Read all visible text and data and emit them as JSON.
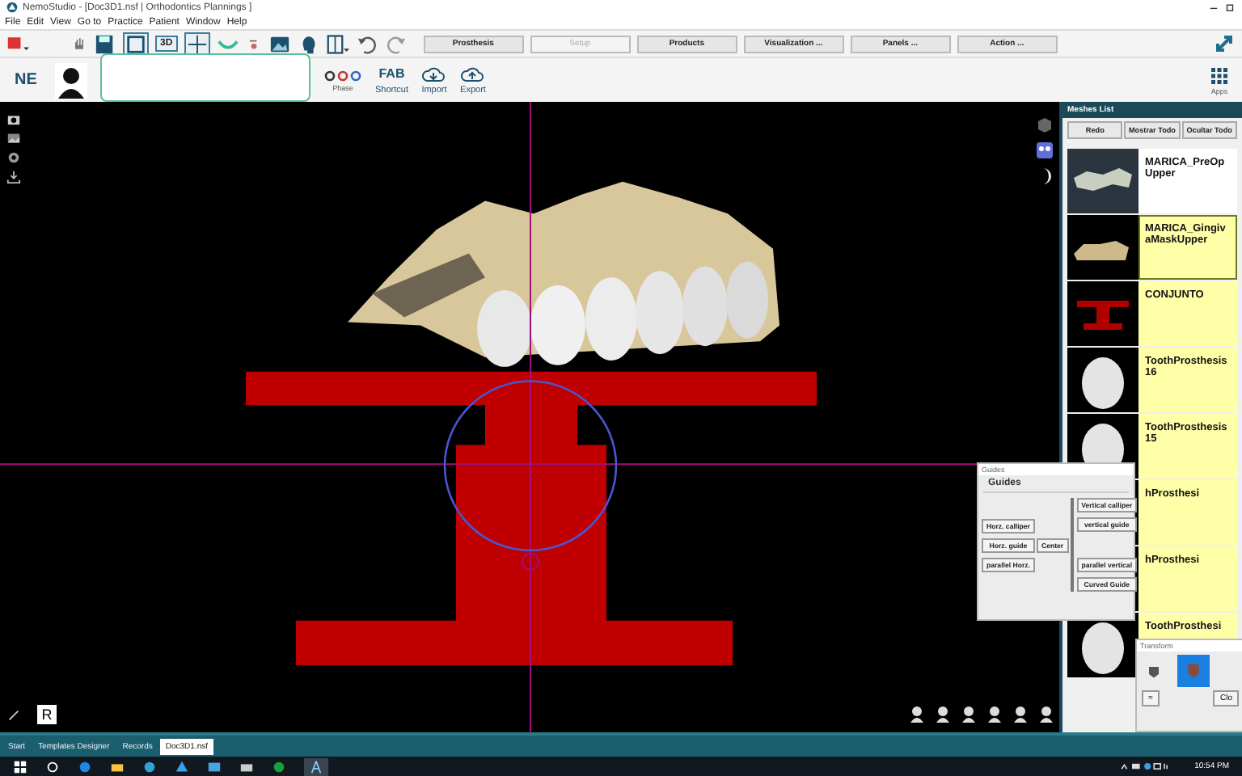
{
  "window": {
    "title": "NemoStudio - [Doc3D1.nsf | Orthodontics Plannings ]"
  },
  "menu": [
    "File",
    "Edit",
    "View",
    "Go to",
    "Practice",
    "Patient",
    "Window",
    "Help"
  ],
  "toolbar_buttons": [
    {
      "label": "Prosthesis",
      "disabled": false
    },
    {
      "label": "Setup",
      "disabled": true
    },
    {
      "label": "Products",
      "disabled": false
    },
    {
      "label": "Visualization ...",
      "disabled": false
    },
    {
      "label": "Panels ...",
      "disabled": false
    },
    {
      "label": "Action ...",
      "disabled": false
    }
  ],
  "view_3d_label": "3D",
  "ribbon": {
    "logo": "NE",
    "fab": "FAB",
    "phase_label": "Phase",
    "shortcut": "Shortcut",
    "import": "Import",
    "export": "Export",
    "apps": "Apps"
  },
  "meshes_list": {
    "title": "Meshes List",
    "buttons": [
      "Redo",
      "Mostrar Todo",
      "Ocultar Todo"
    ],
    "items": [
      {
        "name": "MARICA_PreOpUpper",
        "kind": "gumlight",
        "selected": false,
        "active": false
      },
      {
        "name": "MARICA_GingivaMaskUpper",
        "kind": "gum",
        "selected": true,
        "active": true
      },
      {
        "name": "CONJUNTO",
        "kind": "block",
        "selected": false,
        "active": true
      },
      {
        "name": "ToothProsthesis16",
        "kind": "tooth",
        "selected": false,
        "active": true
      },
      {
        "name": "ToothProsthesis15",
        "kind": "tooth",
        "selected": false,
        "active": true
      },
      {
        "name": "hProsthesi",
        "kind": "tooth",
        "selected": false,
        "active": true
      },
      {
        "name": "hProsthesi",
        "kind": "tooth",
        "selected": false,
        "active": true
      },
      {
        "name": "ToothProsthesi",
        "kind": "tooth",
        "selected": false,
        "active": true
      }
    ]
  },
  "guides_dialog": {
    "title": "Guides",
    "group": "Guides",
    "left_buttons": [
      "Horz. calliper",
      "Horz. guide",
      "parallel Horz."
    ],
    "center": "Center",
    "right_top_buttons": [
      "Vertical calliper",
      "vertical guide"
    ],
    "right_bottom_buttons": [
      "parallel vertical",
      "Curved Guide"
    ]
  },
  "transform_dialog": {
    "title": "Transform",
    "button": "≈",
    "close": "Clo"
  },
  "viewport": {
    "reset_key": "R"
  },
  "doc_tabs": [
    {
      "label": "Start",
      "selected": false
    },
    {
      "label": "Templates Designer",
      "selected": false
    },
    {
      "label": "Records",
      "selected": false
    },
    {
      "label": "Doc3D1.nsf",
      "selected": true
    }
  ],
  "taskbar": {
    "time": "10:54 PM"
  }
}
